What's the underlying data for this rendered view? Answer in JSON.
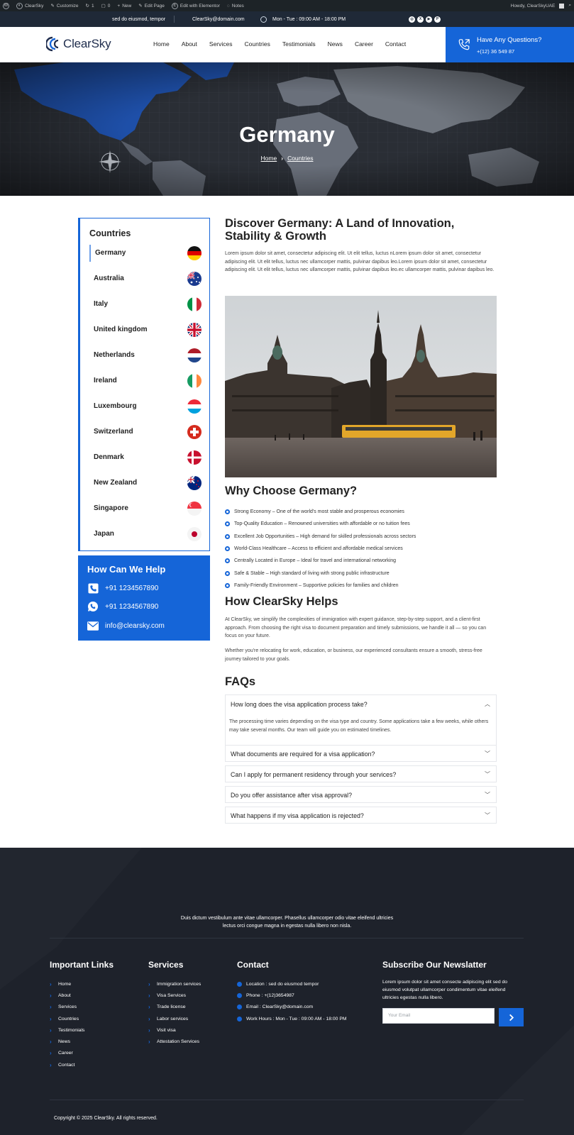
{
  "admin_bar": {
    "site": "ClearSky",
    "customize": "Customize",
    "updates": "1",
    "comments": "0",
    "new": "New",
    "edit_page": "Edit Page",
    "elementor": "Edit with Elementor",
    "notes": "Notes",
    "howdy": "Howdy, ClearSkyUAE"
  },
  "topbar": {
    "address": "sed do eiusmod, tempor",
    "email": "ClearSky@domain.com",
    "hours": "Mon - Tue : 09:00 AM - 18:00 PM"
  },
  "header": {
    "logo": "ClearSky",
    "nav": [
      "Home",
      "About",
      "Services",
      "Countries",
      "Testimonials",
      "News",
      "Career",
      "Contact"
    ],
    "cta_question": "Have Any Questions?",
    "cta_phone": "+(12) 36 549 87"
  },
  "hero": {
    "title": "Germany",
    "crumb_home": "Home",
    "crumb_current": "Countries"
  },
  "sidebar": {
    "title": "Countries",
    "countries": [
      "Germany",
      "Australia",
      "Italy",
      "United kingdom",
      "Netherlands",
      "Ireland",
      "Luxembourg",
      "Switzerland",
      "Denmark",
      "New Zealand",
      "Singapore",
      "Japan"
    ],
    "help_title": "How Can We Help",
    "phone": "+91 1234567890",
    "whatsapp": "+91 1234567890",
    "email": "info@clearsky.com"
  },
  "main": {
    "title": "Discover Germany: A Land of Innovation, Stability & Growth",
    "intro": "Lorem ipsum dolor sit amet, consectetur adipiscing elit. Ut elit tellus, luctus nLorem ipsum dolor sit amet, consectetur adipiscing elit. Ut elit tellus, luctus nec ullamcorper mattis, pulvinar dapibus leo.Lorem ipsum dolor sit amet, consectetur adipiscing elit. Ut elit tellus, luctus nec ullamcorper mattis, pulvinar dapibus leo.ec ullamcorper mattis, pulvinar dapibus leo.",
    "why_title": "Why Choose Germany?",
    "why": [
      "Strong Economy – One of the world's most stable and prosperous economies",
      "Top-Quality Education – Renowned universities with affordable or no tuition fees",
      "Excellent Job Opportunities – High demand for skilled professionals across sectors",
      "World-Class Healthcare – Access to efficient and affordable medical services",
      "Centrally Located in Europe – Ideal for travel and international networking",
      "Safe & Stable – High standard of living with strong public infrastructure",
      "Family-Friendly Environment – Supportive policies for families and children"
    ],
    "helps_title": "How ClearSky Helps",
    "helps_p1": "At ClearSky, we simplify the complexities of immigration with expert guidance, step-by-step support, and a client-first approach. From choosing the right visa to document preparation and timely submissions, we handle it all — so you can focus on your future.",
    "helps_p2": "Whether you're relocating for work, education, or business, our experienced consultants ensure a smooth, stress-free journey tailored to your goals.",
    "faq_title": "FAQs",
    "faqs": [
      {
        "q": "How long does the visa application process take?",
        "a": "The processing time varies depending on the visa type and country. Some applications take a few weeks, while others may take several months. Our team will guide you on estimated timelines."
      },
      {
        "q": "What documents are required for a visa application?"
      },
      {
        "q": "Can I apply for permanent residency through your services?"
      },
      {
        "q": "Do you offer assistance after visa approval?"
      },
      {
        "q": "What happens if my visa application is rejected?"
      }
    ]
  },
  "footer": {
    "intro": "Duis dictum vestibulum ante vitae ullamcorper. Phasellus ullamcorper odio vitae eleifend ultricies lectus orci congue magna in egestas nulla libero non nisla.",
    "links_title": "Important Links",
    "links": [
      "Home",
      "About",
      "Services",
      "Countries",
      "Testimonials",
      "News",
      "Career",
      "Contact"
    ],
    "services_title": "Services",
    "services": [
      "Immigration services",
      "Visa Services",
      "Trade license",
      "Labor services",
      "Visit visa",
      "Attestation Services"
    ],
    "contact_title": "Contact",
    "contact": [
      "Location : sed do eiusmod tempor",
      "Phone : +(12)3654987",
      "Email : ClearSky@domain.com",
      "Work Hours : Mon - Tue : 09:00 AM - 18:00 PM"
    ],
    "newsletter_title": "Subscribe Our Newslatter",
    "newsletter_text": "Lorem ipsum dolor sit amet consecte adipiscing elit sed do eiusmod volutpat ullamcorper condimentum vitae eleifend ultricies egestas nulla libero.",
    "email_placeholder": "Your Email",
    "copyright": "Copyright © 2025 ClearSky. All rights reserved."
  },
  "colors": {
    "accent": "#1565d8",
    "dark": "#1e222b",
    "topbar": "#1f2937"
  }
}
